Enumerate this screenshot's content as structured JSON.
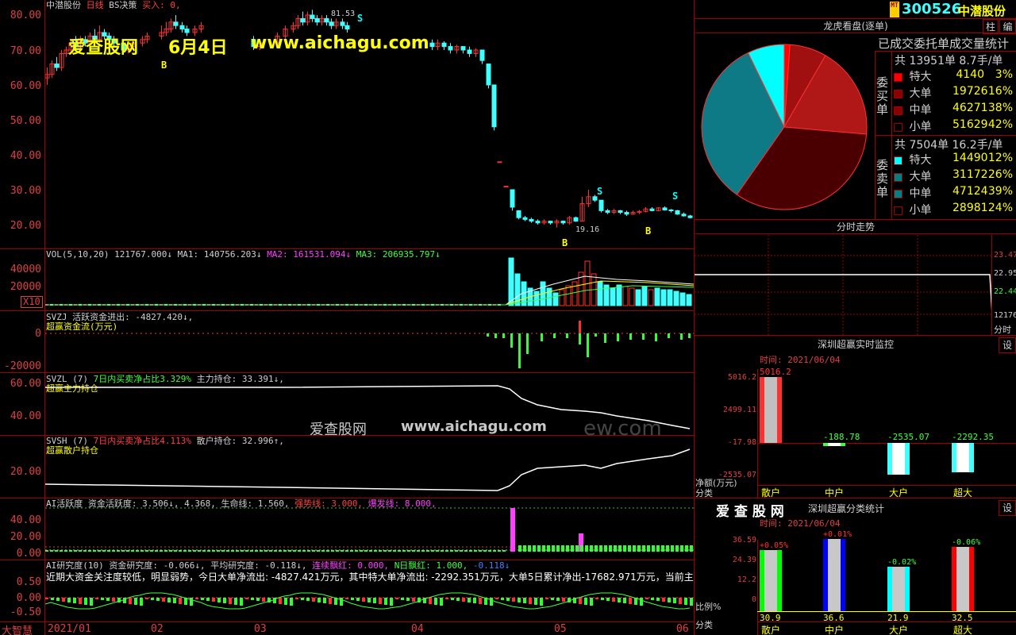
{
  "main_chart": {
    "stock_name": "中潜股份",
    "period": "日线",
    "strategy": "BS决策",
    "buy_label": "买入: 0,",
    "y_ticks": [
      "80.00",
      "70.00",
      "60.00",
      "50.00",
      "40.00",
      "30.00",
      "20.00"
    ],
    "high_label": "81.53",
    "low_label": "19.16",
    "signal_B": "B",
    "signal_S": "S"
  },
  "watermark": {
    "site": "爱查股网",
    "date": "6月4日",
    "url": "www.aichagu.com",
    "mid_site": "爱查股网",
    "mid_url": "www.aichagu.com",
    "ghost": "ew.com"
  },
  "vol_panel": {
    "title": "VOL(5,10,20)",
    "val": "121767.000↓",
    "ma1": "MA1: 140756.203↓",
    "ma2": "MA2: 161531.094↓",
    "ma3": "MA3: 206935.797↓",
    "y_ticks": [
      "40000",
      "20000"
    ],
    "x10": "X10"
  },
  "svzj_panel": {
    "title": "SVZJ",
    "text": "活跃资金进出: -4827.420↓,",
    "sub": "超赢资金流(万元)",
    "y_ticks": [
      "0",
      "-20000"
    ]
  },
  "svzl_panel": {
    "title": "SVZL (7)",
    "green": "7日内买卖净占比3.329%",
    "main": "主力持仓: 33.391↓,",
    "sub": "超赢主力持仓",
    "y_ticks": [
      "60.00",
      "40.00"
    ]
  },
  "svsh_panel": {
    "title": "SVSH (7)",
    "red": "7日内买卖净占比4.113%",
    "main": "散户持仓: 32.996↑,",
    "sub": "超赢散户持仓",
    "y_ticks": [
      "20.00"
    ]
  },
  "ai_panel": {
    "title": "AI活跃度",
    "text": "资金活跃度: 3.506↓, 4.368, 生命线: 1.560,",
    "strong": "强势线: 3.000,",
    "burst": "爆发线: 8.000,",
    "y_ticks": [
      "40.00",
      "20.00",
      "0.00"
    ]
  },
  "research_panel": {
    "title": "AI研究度(10)",
    "text": "资金研究度: -0.066↓, 平均研究度: -0.118↓,",
    "red1": "连续飘红: 0.000,",
    "green1": "N日飘红: 1.000,",
    "blue1": "-0.118↓",
    "comment": "近期大资金关注度较低，明显弱势，今日大单净流出: -4827.421万元，其中特大单净流出: -2292.351万元，大单5日累计净出-17682.971万元，当前主力控",
    "y_ticks": [
      "0.50",
      "0.00",
      "-0.50"
    ]
  },
  "x_axis": {
    "brand": "大智慧",
    "labels": [
      "2021/01",
      "02",
      "03",
      "04",
      "05",
      "06"
    ]
  },
  "header": {
    "mt": "MT",
    "code": "300526",
    "name": "中潜股份",
    "btn_zhu": "柱",
    "btn_bian": "编"
  },
  "longhu": {
    "title": "龙虎看盘(逐单)",
    "subtitle": "已成交委托单成交量统计",
    "buy_label": "委买单",
    "sell_label": "委卖单",
    "buy_total": "共 13951单 8.7手/单",
    "sell_total": "共 7504单 16.2手/单",
    "buy_rows": [
      {
        "name": "特大",
        "count": "4140",
        "pct": "3%",
        "color": "#ff0000"
      },
      {
        "name": "大单",
        "count": "19726",
        "pct": "16%",
        "color": "#8b0000"
      },
      {
        "name": "中单",
        "count": "46271",
        "pct": "38%",
        "color": "#8b0000"
      },
      {
        "name": "小单",
        "count": "51629",
        "pct": "42%",
        "color": "#000000"
      }
    ],
    "sell_rows": [
      {
        "name": "特大",
        "count": "14490",
        "pct": "12%",
        "color": "#00ffff"
      },
      {
        "name": "大单",
        "count": "31172",
        "pct": "26%",
        "color": "#008080"
      },
      {
        "name": "中单",
        "count": "47124",
        "pct": "39%",
        "color": "#008080"
      },
      {
        "name": "小单",
        "count": "28981",
        "pct": "24%",
        "color": "#000000"
      }
    ],
    "pie_colors": [
      "#ff0000",
      "#a01010",
      "#b01818",
      "#4a0000",
      "#0d7a85",
      "#00ffff"
    ]
  },
  "fenshi": {
    "title": "分时走势",
    "y_ticks": [
      "23.47",
      "22.95",
      "22.44",
      "12176"
    ],
    "label": "分时"
  },
  "realtime": {
    "title": "深圳超赢实时监控",
    "btn": "设",
    "time": "时间: 2021/06/04",
    "y_ticks": [
      "5016.2",
      "2499.11",
      "-17.98",
      "-2535.07"
    ],
    "top_value": "5016.2",
    "bars": [
      {
        "label": "散户",
        "value": "5016.2"
      },
      {
        "label": "中户",
        "value": "-188.78"
      },
      {
        "label": "大户",
        "value": "-2535.07"
      },
      {
        "label": "超大",
        "value": "-2292.35"
      }
    ],
    "axis_labels": [
      "净额(万元)",
      "分类"
    ]
  },
  "category": {
    "logo": "爱 查 股 网",
    "title": "深圳超赢分类统计",
    "btn": "设",
    "time": "时间: 2021/06/04",
    "y_ticks": [
      "36.59",
      "24.39",
      "12.2",
      "0"
    ],
    "bars": [
      {
        "label": "散户",
        "pct": "30.9",
        "delta": "+0.05%",
        "color": "#00ff00"
      },
      {
        "label": "中户",
        "pct": "36.6",
        "delta": "+0.01%",
        "color": "#0000ff"
      },
      {
        "label": "大户",
        "pct": "21.9",
        "delta": "-0.02%",
        "color": "#00ffff"
      },
      {
        "label": "超大",
        "pct": "32.5",
        "delta": "-0.06%",
        "color": "#ff0000"
      }
    ],
    "axis_labels": [
      "比例%",
      "分类"
    ]
  }
}
